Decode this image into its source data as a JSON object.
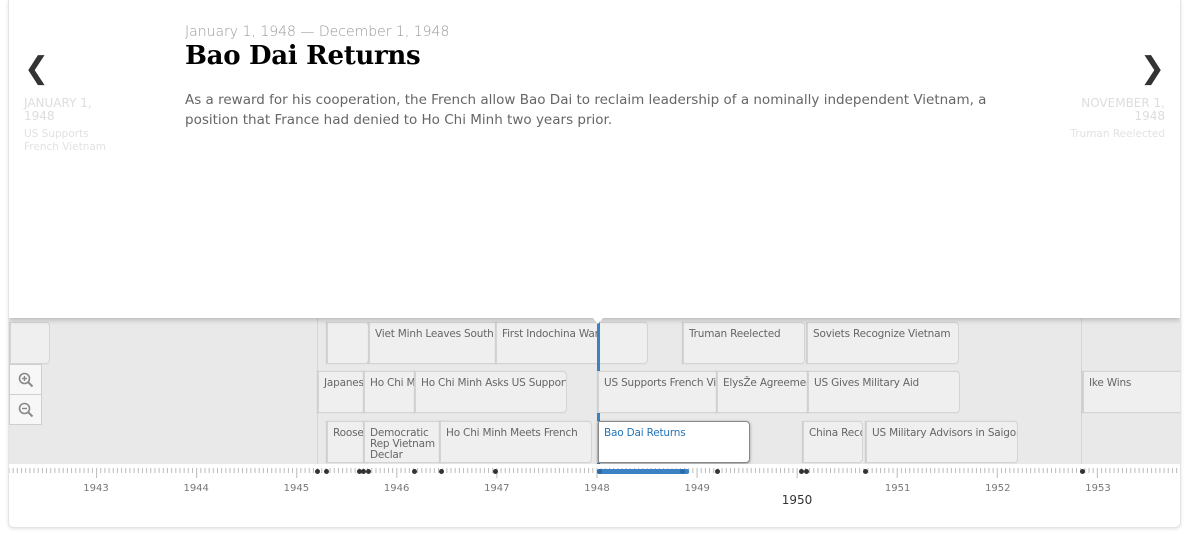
{
  "slide": {
    "date_range": "January 1, 1948 — December 1, 1948",
    "title": "Bao Dai Returns",
    "body": "As a reward for his cooperation, the French allow Bao Dai to reclaim leadership of a nominally independent Vietnam, a position that France had denied to Ho Chi Minh two years prior."
  },
  "nav": {
    "prev": {
      "arrow": "❮",
      "date": "January 1, 1948",
      "title": "US Supports French Vietnam"
    },
    "next": {
      "arrow": "❯",
      "date": "November 1, 1948",
      "title": "Truman Reelected"
    }
  },
  "markers": [
    {
      "label": "Viet Minh Leaves South",
      "row": 0
    },
    {
      "label": "First Indochina War",
      "row": 0
    },
    {
      "label": "Truman Reelected",
      "row": 0
    },
    {
      "label": "Soviets Recognize Vietnam",
      "row": 0
    },
    {
      "label": "Japanese",
      "row": 1
    },
    {
      "label": "Ho Chi Mi",
      "row": 1
    },
    {
      "label": "Ho Chi Minh Asks US Support",
      "row": 1
    },
    {
      "label": "US Supports French Vietn",
      "row": 1
    },
    {
      "label": "ElysŽe Agreement",
      "row": 1
    },
    {
      "label": "US Gives Military Aid",
      "row": 1
    },
    {
      "label": "Ike Wins",
      "row": 1
    },
    {
      "label": "Roose",
      "row": 2
    },
    {
      "label": "Democratic Rep Vietnam Declar",
      "row": 2
    },
    {
      "label": "Ho Chi Minh Meets French",
      "row": 2
    },
    {
      "label": "Bao Dai Returns",
      "row": 2,
      "active": true
    },
    {
      "label": "China Recog",
      "row": 2
    },
    {
      "label": "US Military Advisors in Saigon",
      "row": 2
    }
  ],
  "axis": {
    "years": [
      "1943",
      "1944",
      "1945",
      "1946",
      "1947",
      "1948",
      "1949",
      "1950",
      "1951",
      "1952",
      "1953"
    ],
    "era_label": "1950"
  },
  "icons": {
    "zoom_in": "zoom-in-icon",
    "zoom_out": "zoom-out-icon"
  },
  "colors": {
    "accent": "#3b82c4",
    "title": "#000000",
    "body": "#666666"
  }
}
